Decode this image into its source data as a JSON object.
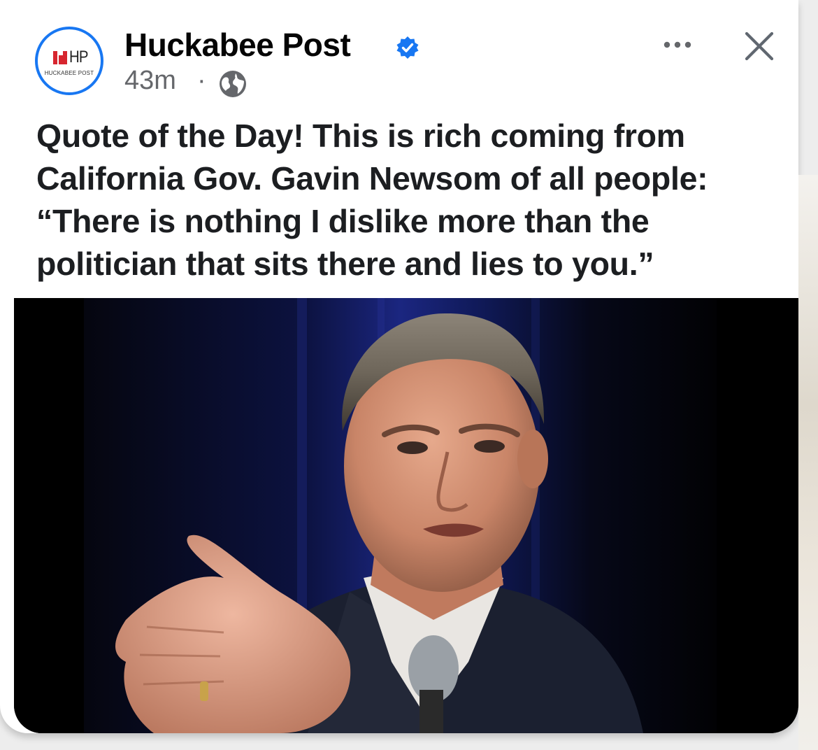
{
  "post": {
    "page_name": "Huckabee Post",
    "verified": true,
    "timestamp": "43m",
    "separator": "·",
    "audience_icon": "globe-icon",
    "avatar": {
      "logo_text": "HP",
      "logo_subtext": "HUCKABEE POST",
      "logo_icon": "three-red-bars-icon"
    },
    "text_lines": [
      "Quote of the Day! This is rich coming from",
      "California Gov. Gavin Newsom of all people:",
      "“There is nothing I dislike more than the",
      "politician that sits there and lies to you.”"
    ],
    "header_actions": {
      "more_icon": "more-horizontal-icon",
      "close_icon": "close-icon"
    },
    "image": {
      "subject": "photo-of-speaker-with-microphone"
    }
  },
  "colors": {
    "accent": "#1877f2",
    "text_primary": "#050505",
    "text_secondary": "#65676b",
    "logo_red": "#d7262f",
    "photo_background": "#000000",
    "stage_curtain": "#1a2470"
  }
}
